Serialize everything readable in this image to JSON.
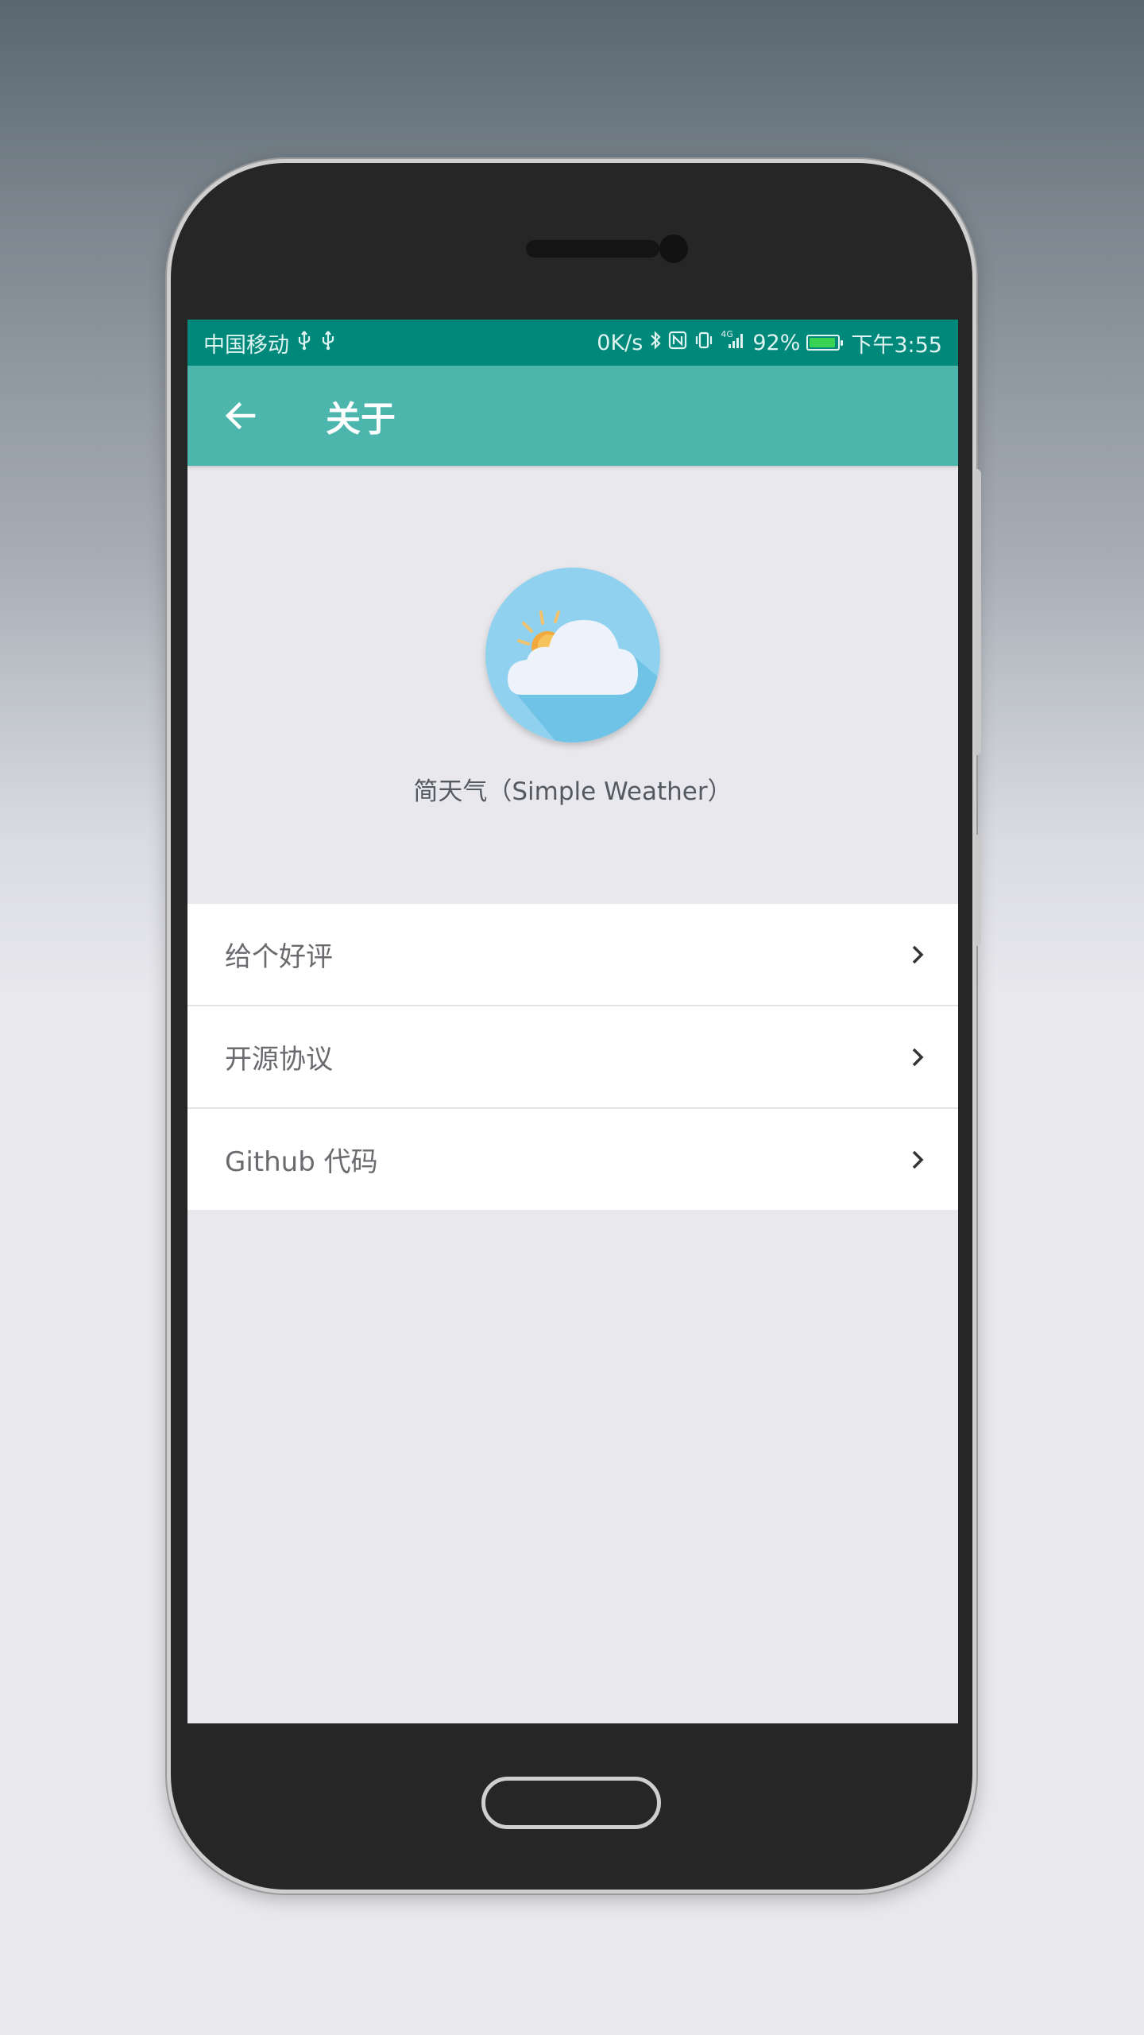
{
  "status_bar": {
    "carrier": "中国移动",
    "usb_icons": [
      "usb-icon",
      "usb-icon"
    ],
    "net_speed": "0K/s",
    "network_type": "4G",
    "battery_percent": "92%",
    "battery_level": 0.92,
    "time": "下午3:55"
  },
  "app_bar": {
    "title": "关于",
    "back_icon": "arrow-left-icon"
  },
  "about": {
    "logo_icon": "weather-cloud-sun-icon",
    "app_name": "简天气（Simple Weather）"
  },
  "menu": {
    "items": [
      {
        "label": "给个好评",
        "icon": "chevron-right-icon"
      },
      {
        "label": "开源协议",
        "icon": "chevron-right-icon"
      },
      {
        "label": "Github 代码",
        "icon": "chevron-right-icon"
      }
    ]
  },
  "colors": {
    "status_bar": "#00897b",
    "app_bar": "#4db6ac",
    "background": "#e8e8ed",
    "logo_circle": "#90d3ef"
  }
}
